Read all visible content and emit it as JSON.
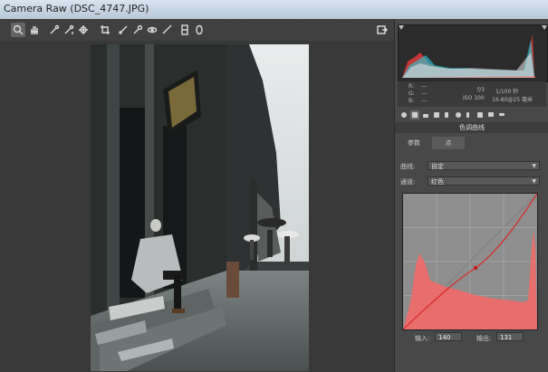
{
  "window": {
    "title": "Camera Raw (DSC_4747.JPG)"
  },
  "toolbar": {
    "tools": [
      "zoom-icon",
      "hand-icon",
      "eyedropper-icon",
      "color-sampler-icon",
      "target-adjust-icon",
      "crop-icon",
      "straighten-icon",
      "spot-removal-icon",
      "redeye-icon",
      "brush-icon",
      "graduated-filter-icon",
      "radial-filter-icon"
    ],
    "export_icon": "open-preferences-icon"
  },
  "exif": {
    "r_label": "R:",
    "r_value": "---",
    "g_label": "G:",
    "g_value": "---",
    "b_label": "B:",
    "b_value": "---",
    "aperture": "f/3",
    "shutter": "1/100 秒",
    "iso": "ISO 100",
    "lens": "16-80@25 毫米"
  },
  "panel": {
    "section_title": "色调曲线",
    "tabs": [
      "参数",
      "点"
    ],
    "active_tab": 1,
    "curve_label": "曲线:",
    "curve_value": "自定",
    "channel_label": "通道:",
    "channel_value": "红色",
    "input_label": "输入:",
    "input_value": "140",
    "output_label": "输出:",
    "output_value": "131"
  },
  "colors": {
    "histogram_red": "#e03838",
    "histogram_cyan": "#20d0e0",
    "curve_fill": "#f06a6a",
    "curve_line": "#d82c2c"
  }
}
